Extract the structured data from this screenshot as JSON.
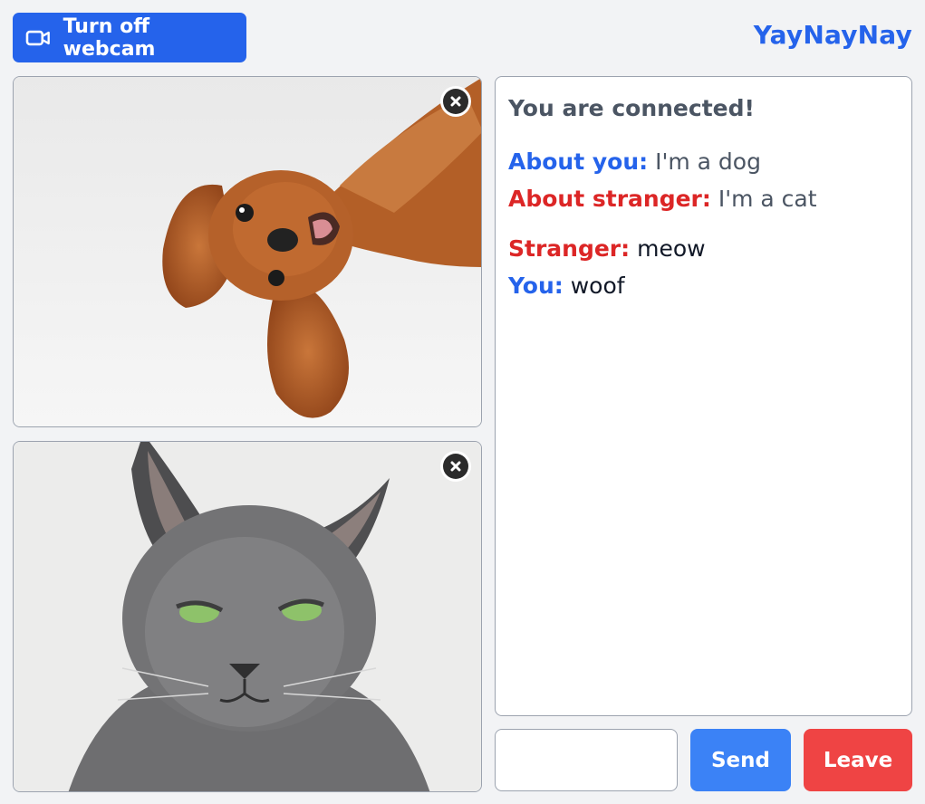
{
  "header": {
    "webcam_button_label": "Turn off webcam",
    "webcam_icon": "video-camera-icon",
    "brand": "YayNayNay"
  },
  "videos": [
    {
      "subject": "dog",
      "close_icon": "close-icon"
    },
    {
      "subject": "cat",
      "close_icon": "close-icon"
    }
  ],
  "chat": {
    "status": "You are connected!",
    "about_you_label": "About you:",
    "about_you_value": "I'm a dog",
    "about_stranger_label": "About stranger:",
    "about_stranger_value": "I'm a cat",
    "messages": [
      {
        "sender": "Stranger:",
        "text": "meow"
      },
      {
        "sender": "You:",
        "text": "woof"
      }
    ]
  },
  "composer": {
    "input_value": "",
    "input_placeholder": "",
    "send_label": "Send",
    "leave_label": "Leave"
  },
  "colors": {
    "accent_blue": "#2563eb",
    "stranger_red": "#dc2626",
    "send_blue": "#3b82f6",
    "leave_red": "#ef4444",
    "background": "#f2f3f5"
  }
}
